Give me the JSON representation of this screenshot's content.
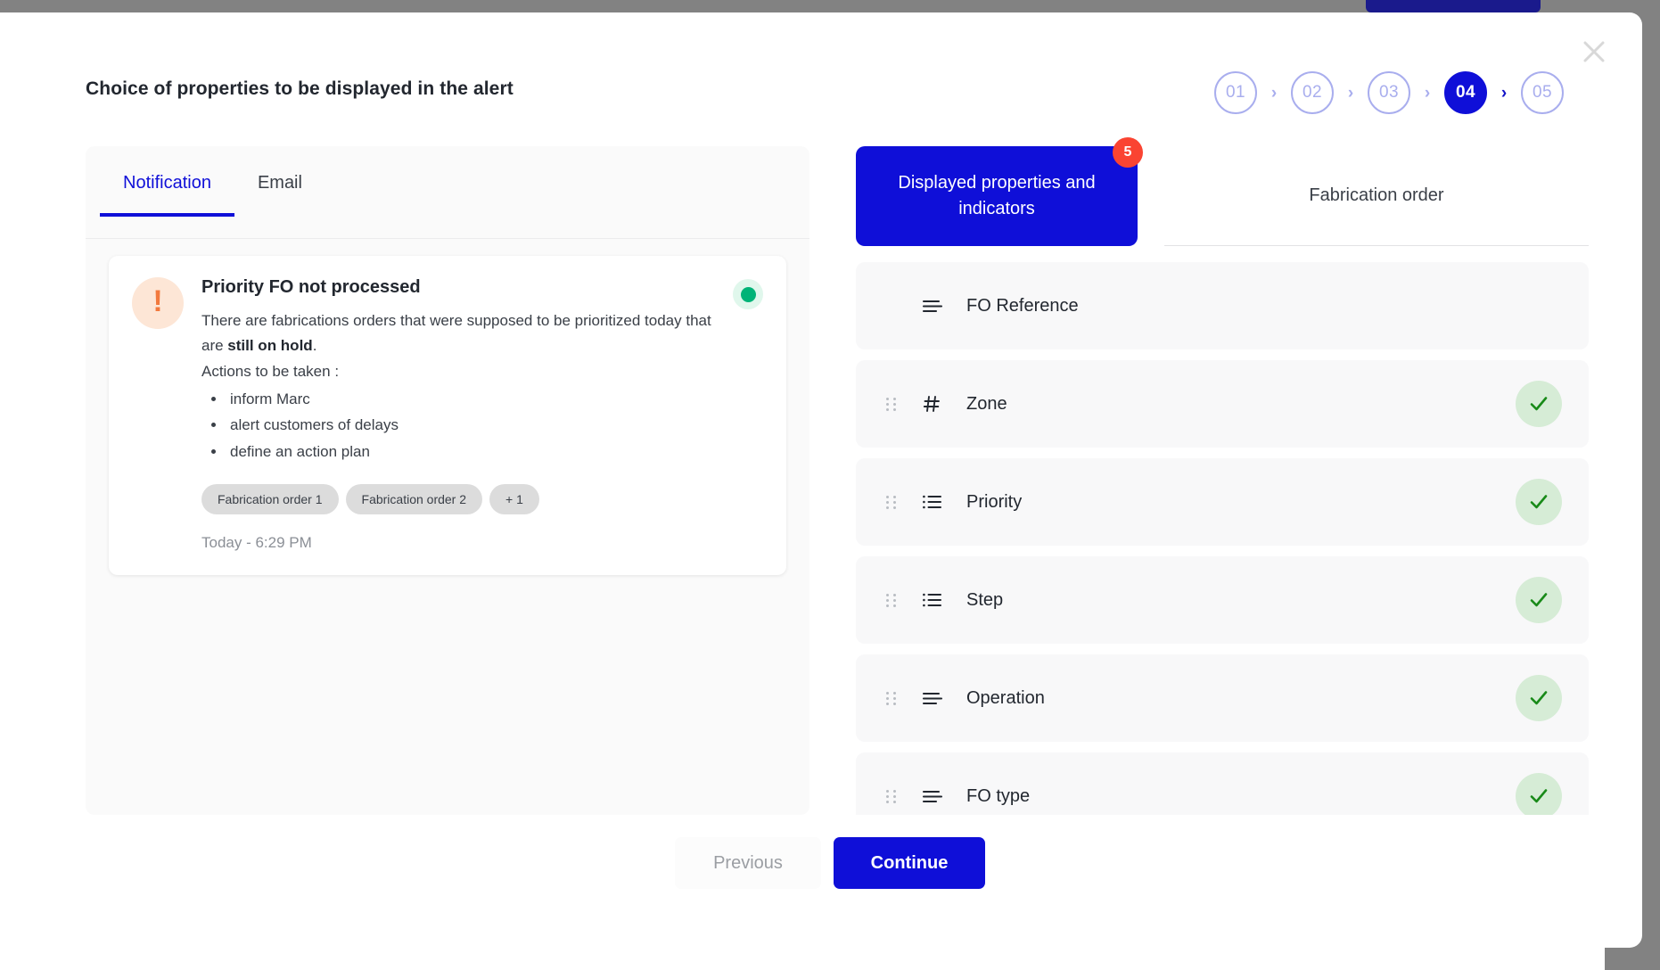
{
  "modal": {
    "title": "Choice of properties to be displayed in the alert",
    "close_icon": "close-icon"
  },
  "stepper": {
    "steps": [
      {
        "label": "01",
        "active": false
      },
      {
        "label": "02",
        "active": false
      },
      {
        "label": "03",
        "active": false
      },
      {
        "label": "04",
        "active": true
      },
      {
        "label": "05",
        "active": false
      }
    ],
    "separator": "›"
  },
  "left_panel": {
    "tabs": [
      {
        "label": "Notification",
        "active": true
      },
      {
        "label": "Email",
        "active": false
      }
    ],
    "notification": {
      "alert_icon": "exclamation-icon",
      "alert_symbol": "!",
      "title": "Priority FO not processed",
      "body_prefix": "There are fabrications orders that were supposed to be prioritized today that are ",
      "body_bold": "still on hold",
      "body_suffix": ".",
      "actions_label": "Actions to be taken :",
      "actions": [
        "inform Marc",
        "alert customers of delays",
        "define an action plan"
      ],
      "tags": [
        "Fabrication order 1",
        "Fabrication order 2",
        "+ 1"
      ],
      "timestamp": "Today - 6:29 PM",
      "status_dot": "status-dot-green"
    }
  },
  "right_panel": {
    "tabs": [
      {
        "label": "Displayed properties and indicators",
        "active": true,
        "badge": "5"
      },
      {
        "label": "Fabrication order",
        "active": false
      }
    ],
    "properties": [
      {
        "label": "FO Reference",
        "icon": "text-lines-icon",
        "draggable": false,
        "checked": false
      },
      {
        "label": "Zone",
        "icon": "hash-icon",
        "draggable": true,
        "checked": true
      },
      {
        "label": "Priority",
        "icon": "bullet-list-icon",
        "draggable": true,
        "checked": true
      },
      {
        "label": "Step",
        "icon": "bullet-list-icon",
        "draggable": true,
        "checked": true
      },
      {
        "label": "Operation",
        "icon": "text-lines-icon",
        "draggable": true,
        "checked": true
      },
      {
        "label": "FO type",
        "icon": "text-lines-icon",
        "draggable": true,
        "checked": true
      }
    ]
  },
  "footer": {
    "previous_label": "Previous",
    "continue_label": "Continue"
  },
  "colors": {
    "accent_blue": "#0f0fd8",
    "badge_red": "#fa4432",
    "check_green": "#188a18",
    "check_bg": "#d6ecd6",
    "status_green": "#00b377",
    "alert_orange": "#f2793d",
    "step_idle": "#a9aeee"
  }
}
